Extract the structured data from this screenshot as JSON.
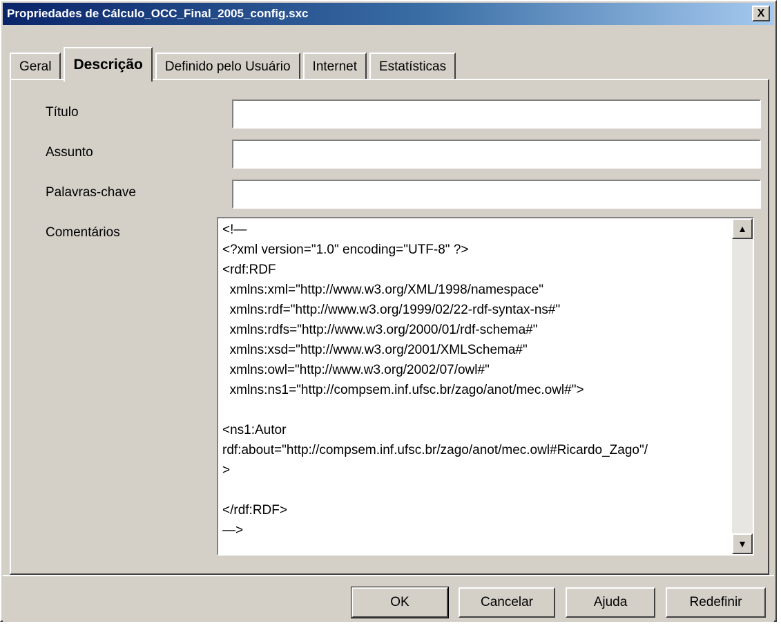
{
  "window": {
    "title": "Propriedades de Cálculo_OCC_Final_2005_config.sxc",
    "close_label": "X"
  },
  "tabs": [
    {
      "label": "Geral"
    },
    {
      "label": "Descrição",
      "active": true
    },
    {
      "label": "Definido pelo Usuário"
    },
    {
      "label": "Internet"
    },
    {
      "label": "Estatísticas"
    }
  ],
  "fields": {
    "titulo": {
      "label": "Título",
      "value": ""
    },
    "assunto": {
      "label": "Assunto",
      "value": ""
    },
    "palavras": {
      "label": "Palavras-chave",
      "value": ""
    },
    "comentarios": {
      "label": "Comentários",
      "value": "<!—\n<?xml version=\"1.0\" encoding=\"UTF-8\" ?>\n<rdf:RDF\n  xmlns:xml=\"http://www.w3.org/XML/1998/namespace\"\n  xmlns:rdf=\"http://www.w3.org/1999/02/22-rdf-syntax-ns#\"\n  xmlns:rdfs=\"http://www.w3.org/2000/01/rdf-schema#\"\n  xmlns:xsd=\"http://www.w3.org/2001/XMLSchema#\"\n  xmlns:owl=\"http://www.w3.org/2002/07/owl#\"\n  xmlns:ns1=\"http://compsem.inf.ufsc.br/zago/anot/mec.owl#\">\n\n<ns1:Autor\nrdf:about=\"http://compsem.inf.ufsc.br/zago/anot/mec.owl#Ricardo_Zago\"/\n>\n\n</rdf:RDF>\n—>"
    }
  },
  "buttons": {
    "ok": "OK",
    "cancel": "Cancelar",
    "help": "Ajuda",
    "reset": "Redefinir"
  },
  "icons": {
    "scroll_up": "up-arrow-icon",
    "scroll_down": "down-arrow-icon",
    "close": "close-icon"
  }
}
